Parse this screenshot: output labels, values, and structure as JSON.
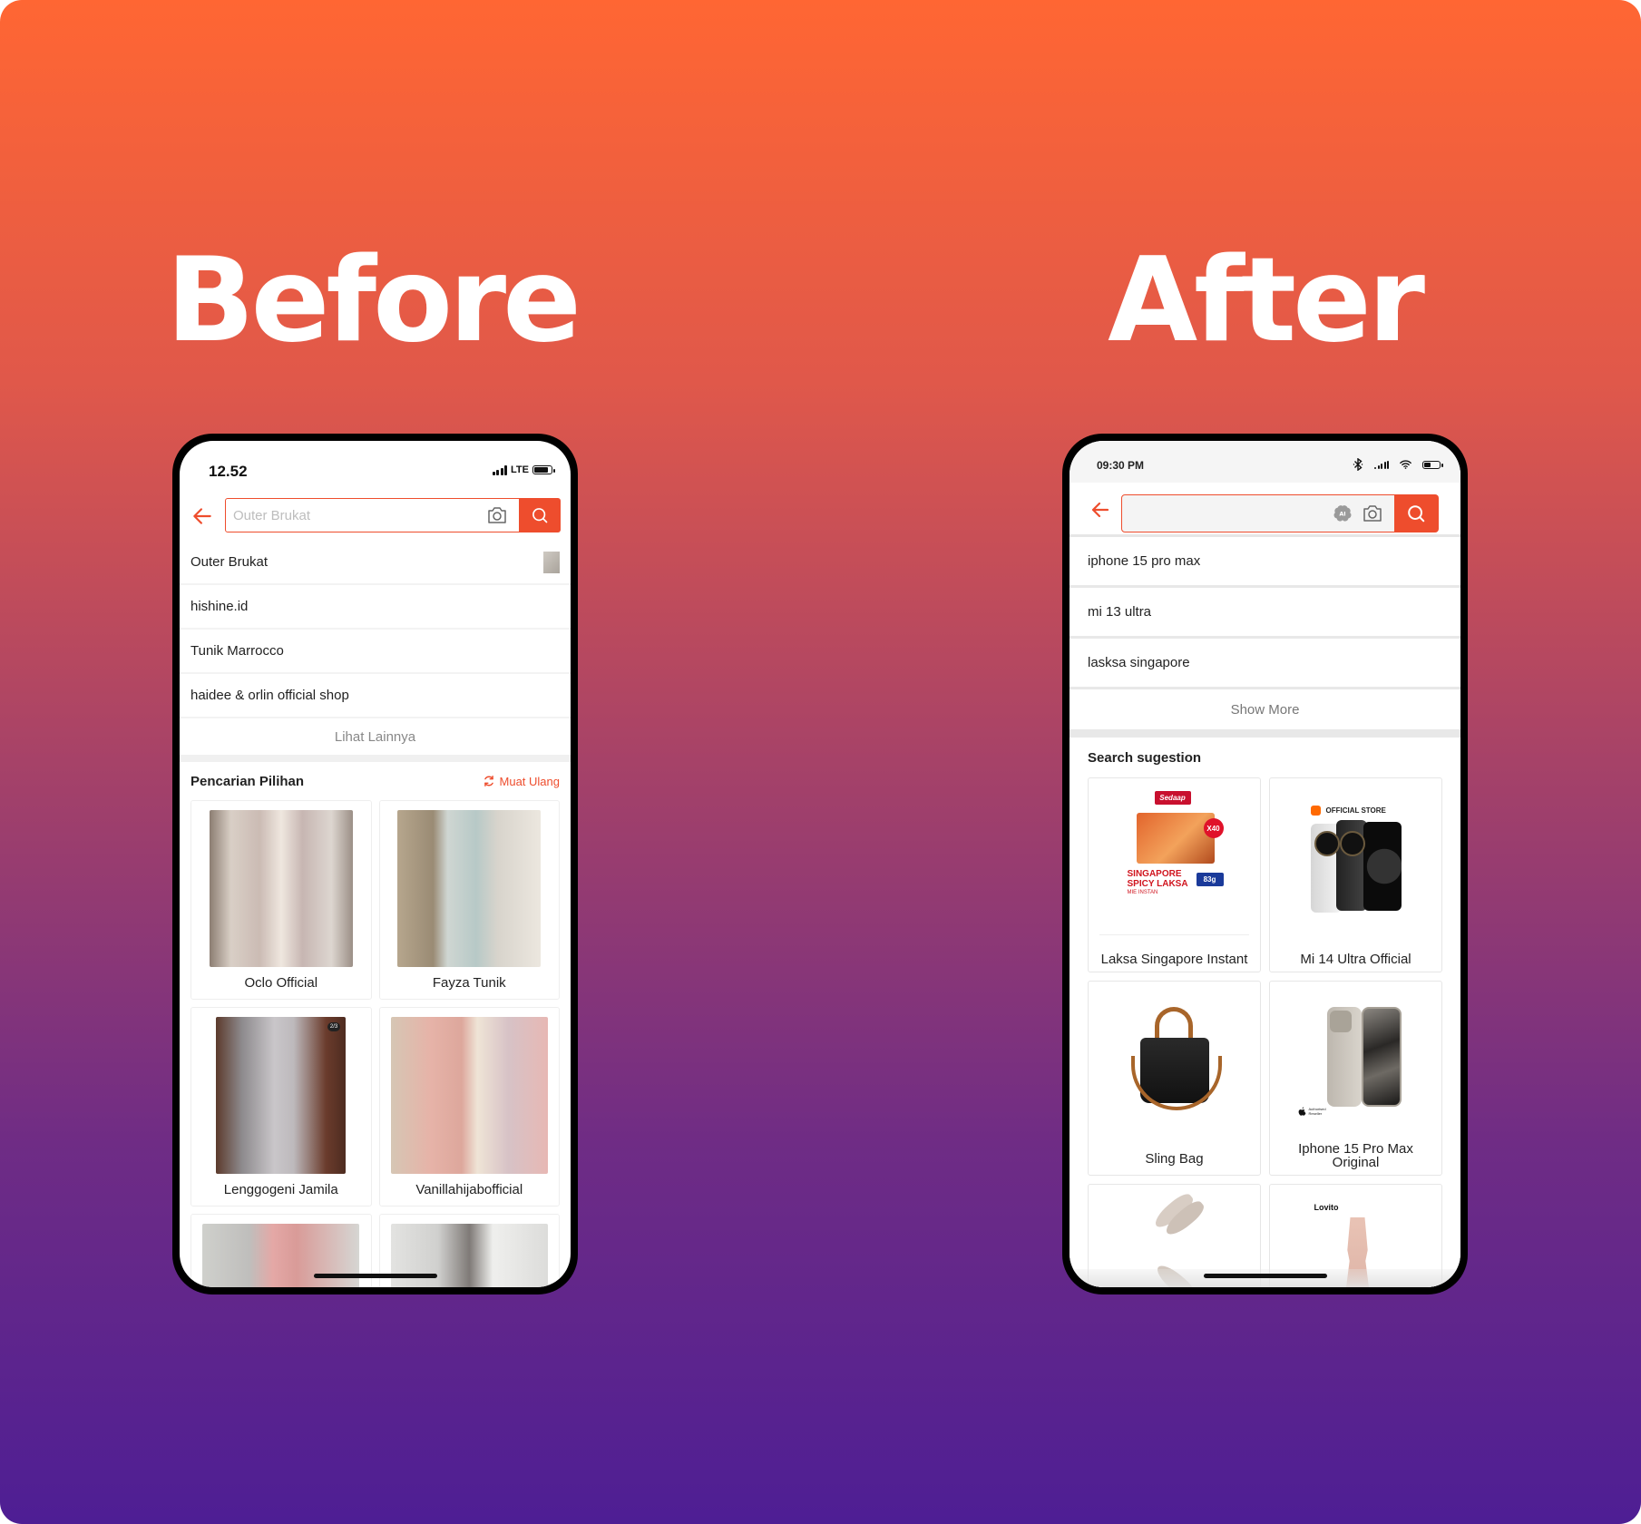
{
  "titles": {
    "before": "Before",
    "after": "After"
  },
  "colors": {
    "accent": "#EE4D2D",
    "gradient_top": "#FF6633",
    "gradient_bottom": "#4E1E94"
  },
  "before": {
    "status": {
      "time": "12.52",
      "network": "LTE"
    },
    "search": {
      "placeholder": "Outer Brukat"
    },
    "history": [
      "Outer Brukat",
      "hishine.id",
      "Tunik Marrocco",
      "haidee & orlin official shop"
    ],
    "see_more": "Lihat Lainnya",
    "section": {
      "title": "Pencarian Pilihan",
      "reload_label": "Muat Ulang"
    },
    "cards": [
      {
        "label": "Oclo Official"
      },
      {
        "label": "Fayza Tunik"
      },
      {
        "label": "Lenggogeni Jamila",
        "badge": "2/3"
      },
      {
        "label": "Vanillahijabofficial"
      },
      {
        "label": ""
      },
      {
        "label": ""
      }
    ]
  },
  "after": {
    "status": {
      "time": "09:30 PM"
    },
    "search": {
      "placeholder": "",
      "ai_icon_text": "AI"
    },
    "history": [
      "iphone 15 pro max",
      "mi 13 ultra",
      "lasksa singapore"
    ],
    "see_more": "Show More",
    "section": {
      "title": "Search sugestion"
    },
    "cards": [
      {
        "label": "Laksa Singapore Instant",
        "brand": "Sedaap",
        "pack_text": "SINGAPORE SPICY LAKSA",
        "pack_sub": "MIE INSTAN",
        "badge": "X40",
        "weight": "83g"
      },
      {
        "label": "Mi 14 Ultra Official",
        "store_tag": "OFFICIAL STORE"
      },
      {
        "label": "Sling Bag"
      },
      {
        "label": "Iphone 15 Pro Max Original",
        "reseller_tag": "Authorised Reseller"
      },
      {
        "label": ""
      },
      {
        "label": "",
        "brand": "Lovito"
      }
    ]
  }
}
